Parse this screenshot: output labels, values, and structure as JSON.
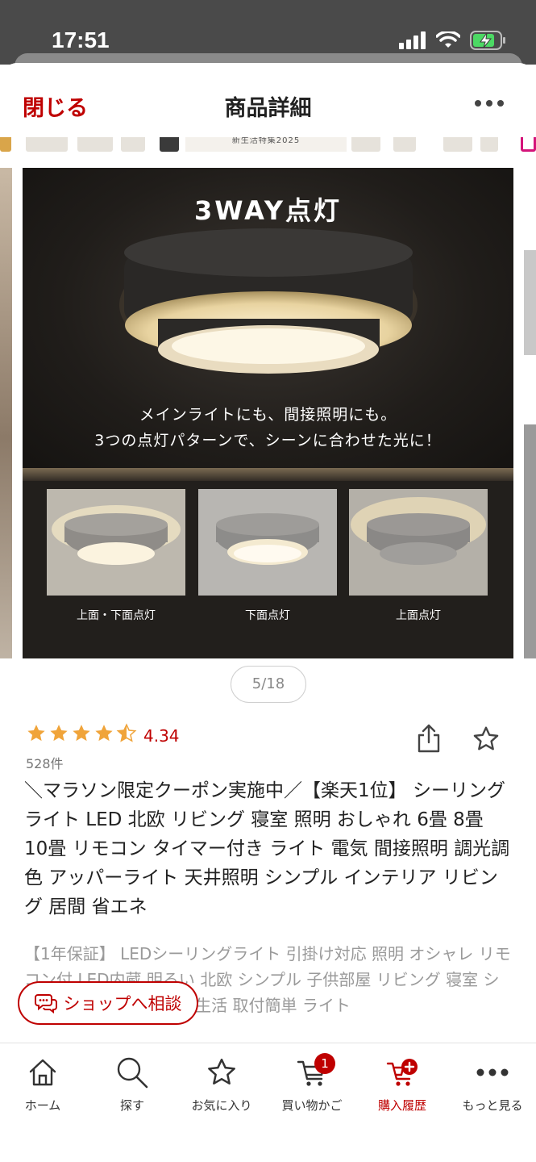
{
  "status_bar": {
    "time": "17:51"
  },
  "header": {
    "close_label": "閉じる",
    "title": "商品詳細"
  },
  "banner": {
    "text": "新生活特集2025"
  },
  "image": {
    "headline": "3WAY点灯",
    "caption_line1": "メインライトにも、間接照明にも。",
    "caption_line2": "3つの点灯パターンで、シーンに合わせた光に！",
    "variants": [
      "上面・下面点灯",
      "下面点灯",
      "上面点灯"
    ],
    "counter": "5/18"
  },
  "product": {
    "stars": 4.5,
    "rating": "4.34",
    "review_count": "528件",
    "title": "＼マラソン限定クーポン実施中／【楽天1位】 シーリングライト LED 北欧 リビング 寝室 照明 おしゃれ 6畳 8畳 10畳 リモコン タイマー付き ライト 電気 間接照明 調光調色 アッパーライト 天井照明 シンプル インテリア リビング 居間 省エネ",
    "catch_copy": "【1年保証】 LEDシーリングライト 引掛け対応 照明 オシャレ リモコン付 LED内蔵 明るい 北欧 シンプル 子供部屋 リビング 寝室 シーリングランプ 食卓 新生活 取付簡単 ライト"
  },
  "shop_button": {
    "label": "ショップへ相談"
  },
  "tabbar": {
    "items": [
      {
        "label": "ホーム",
        "icon": "home-icon"
      },
      {
        "label": "探す",
        "icon": "search-icon"
      },
      {
        "label": "お気に入り",
        "icon": "star-icon"
      },
      {
        "label": "買い物かご",
        "icon": "cart-icon",
        "badge": "1"
      },
      {
        "label": "購入履歴",
        "icon": "purchase-history-icon"
      },
      {
        "label": "もっと見る",
        "icon": "more-icon"
      }
    ]
  },
  "colors": {
    "accent": "#bf0000",
    "star": "#f0a43a"
  }
}
